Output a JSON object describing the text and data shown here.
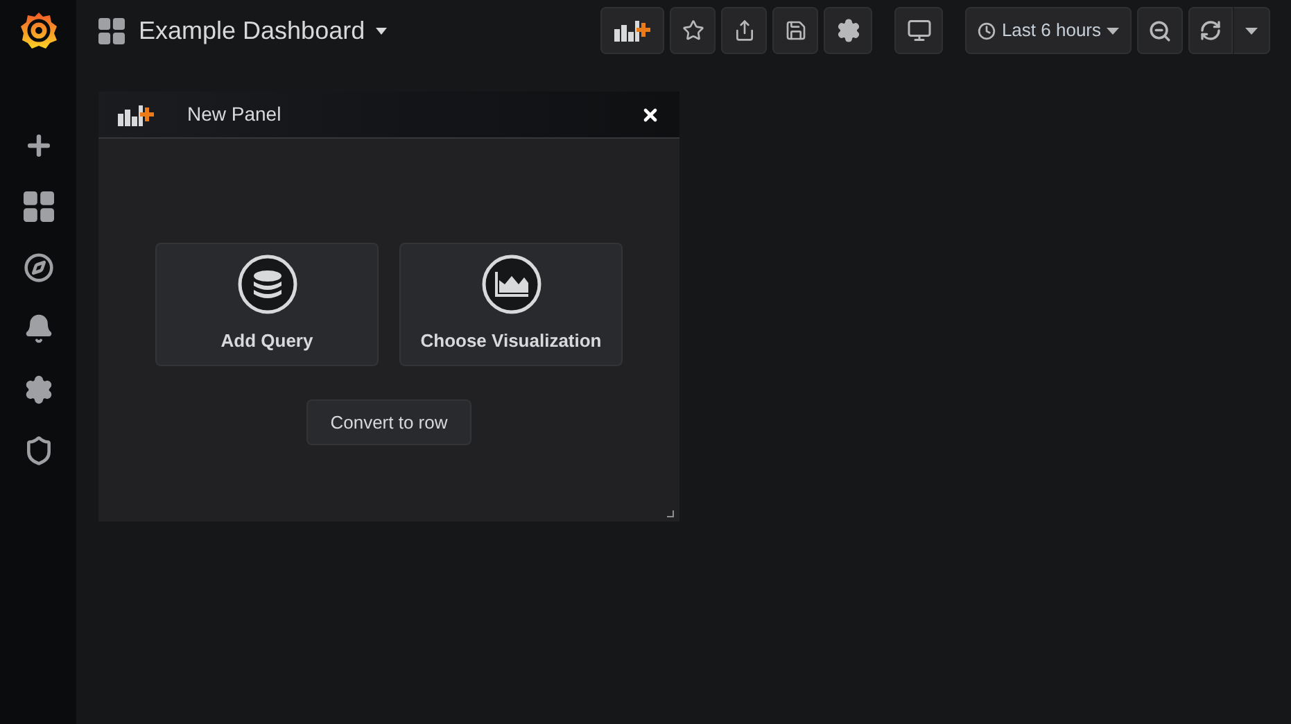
{
  "dashboard": {
    "title": "Example Dashboard"
  },
  "time_picker": {
    "label": "Last 6 hours"
  },
  "panel": {
    "title": "New Panel",
    "actions": [
      {
        "kind": "query",
        "label": "Add Query"
      },
      {
        "kind": "visualization",
        "label": "Choose Visualization"
      }
    ],
    "convert_button": "Convert to row"
  }
}
